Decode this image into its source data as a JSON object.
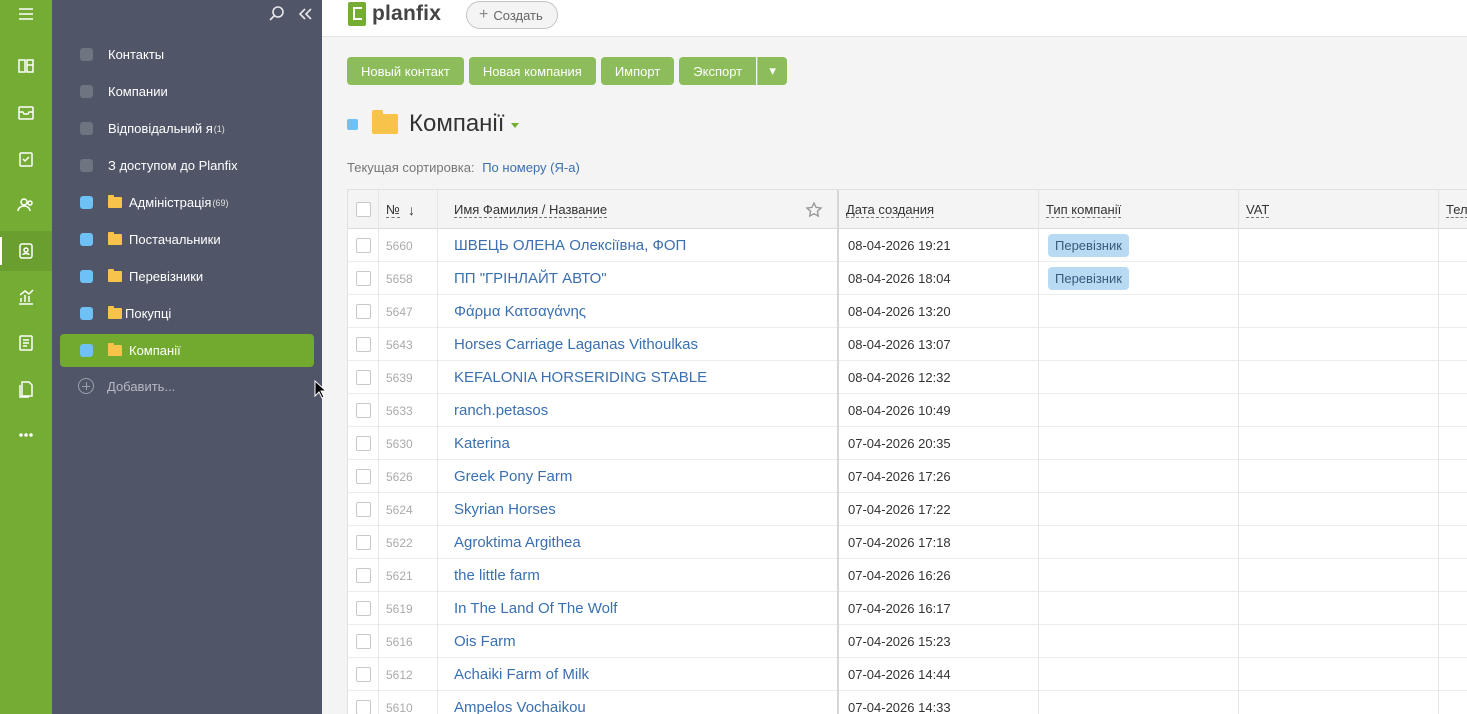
{
  "app": {
    "logo_text": "planfix",
    "create_label": "Создать"
  },
  "rail": {
    "icons": [
      "menu-icon",
      "board-icon",
      "inbox-icon",
      "tasks-icon",
      "people-icon",
      "contacts-icon",
      "analytics-icon",
      "reports-icon",
      "files-icon",
      "more-icon"
    ],
    "active": "contacts-icon",
    "accent": "#74ac34"
  },
  "sidebar": {
    "items": [
      {
        "label": "Контакты",
        "marker": "grey",
        "folder": false,
        "count": ""
      },
      {
        "label": "Компании",
        "marker": "grey",
        "folder": false,
        "count": ""
      },
      {
        "label": "Відповідальний я",
        "marker": "grey",
        "folder": false,
        "count": "(1)"
      },
      {
        "label": "З доступом до Planfix",
        "marker": "grey",
        "folder": false,
        "count": ""
      },
      {
        "label": "Адміністрація",
        "marker": "blue",
        "folder": true,
        "count": "(69)"
      },
      {
        "label": "Постачальники",
        "marker": "blue",
        "folder": true,
        "count": ""
      },
      {
        "label": "Перевізники",
        "marker": "blue",
        "folder": true,
        "count": ""
      },
      {
        "label": "Покупці",
        "marker": "blue",
        "folder": true,
        "count": ""
      },
      {
        "label": "Компанії",
        "marker": "blue",
        "folder": true,
        "count": "",
        "active": true
      }
    ],
    "add_label": "Добавить..."
  },
  "toolbar": {
    "new_contact": "Новый контакт",
    "new_company": "Новая компания",
    "import": "Импорт",
    "export": "Экспорт",
    "export_dropdown": "▾"
  },
  "page": {
    "title": "Компанії",
    "sort_label": "Текущая сортировка:",
    "sort_value": "По номеру (Я-а)"
  },
  "table": {
    "columns": {
      "num": "№",
      "name": "Имя Фамилия / Название",
      "created": "Дата создания",
      "type": "Тип компанії",
      "vat": "VAT",
      "phone": "Тел"
    },
    "rows": [
      {
        "num": "5660",
        "name": "ШВЕЦЬ ОЛЕНА Олексіївна, ФОП",
        "created": "08-04-2026 19:21",
        "type": "Перевізник"
      },
      {
        "num": "5658",
        "name": "ПП \"ГРІНЛАЙТ АВТО\"",
        "created": "08-04-2026 18:04",
        "type": "Перевізник"
      },
      {
        "num": "5647",
        "name": "Φάρμα Κατσαγάνης",
        "created": "08-04-2026 13:20",
        "type": ""
      },
      {
        "num": "5643",
        "name": "Horses Carriage Laganas Vithoulkas",
        "created": "08-04-2026 13:07",
        "type": ""
      },
      {
        "num": "5639",
        "name": "KEFALONIA HORSERIDING STABLE",
        "created": "08-04-2026 12:32",
        "type": ""
      },
      {
        "num": "5633",
        "name": "ranch.petasos",
        "created": "08-04-2026 10:49",
        "type": ""
      },
      {
        "num": "5630",
        "name": "Katerina",
        "created": "07-04-2026 20:35",
        "type": ""
      },
      {
        "num": "5626",
        "name": "Greek Pony Farm",
        "created": "07-04-2026 17:26",
        "type": ""
      },
      {
        "num": "5624",
        "name": "Skyrian Horses",
        "created": "07-04-2026 17:22",
        "type": ""
      },
      {
        "num": "5622",
        "name": "Agroktima Argithea",
        "created": "07-04-2026 17:18",
        "type": ""
      },
      {
        "num": "5621",
        "name": "the little farm",
        "created": "07-04-2026 16:26",
        "type": ""
      },
      {
        "num": "5619",
        "name": "In The Land Of The Wolf",
        "created": "07-04-2026 16:17",
        "type": ""
      },
      {
        "num": "5616",
        "name": "Ois Farm",
        "created": "07-04-2026 15:23",
        "type": ""
      },
      {
        "num": "5612",
        "name": "Achaiki Farm of Milk",
        "created": "07-04-2026 14:44",
        "type": ""
      },
      {
        "num": "5610",
        "name": "Ampelos Vochaikou",
        "created": "07-04-2026 14:33",
        "type": ""
      }
    ]
  }
}
